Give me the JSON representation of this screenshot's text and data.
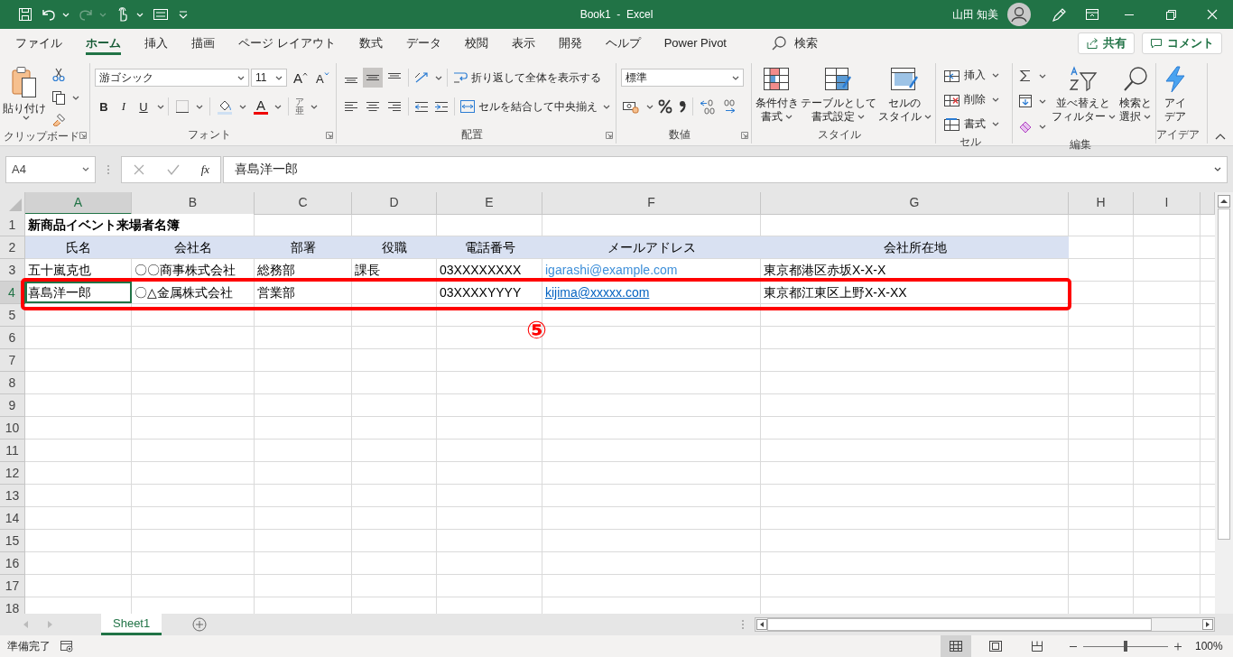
{
  "window": {
    "title": "Book1  -  Excel",
    "user": "山田 知美"
  },
  "quick_access": [
    {
      "kind": "save",
      "disabled": false
    },
    {
      "kind": "undo",
      "disabled": false
    },
    {
      "kind": "redo",
      "disabled": true
    },
    {
      "kind": "touch",
      "disabled": false
    },
    {
      "kind": "form",
      "disabled": false
    },
    {
      "kind": "customize",
      "disabled": false
    }
  ],
  "menu_tabs": [
    {
      "label": "ファイル",
      "selected": false
    },
    {
      "label": "ホーム",
      "selected": true
    },
    {
      "label": "挿入",
      "selected": false
    },
    {
      "label": "描画",
      "selected": false
    },
    {
      "label": "ページ レイアウト",
      "selected": false
    },
    {
      "label": "数式",
      "selected": false
    },
    {
      "label": "データ",
      "selected": false
    },
    {
      "label": "校閲",
      "selected": false
    },
    {
      "label": "表示",
      "selected": false
    },
    {
      "label": "開発",
      "selected": false
    },
    {
      "label": "ヘルプ",
      "selected": false
    },
    {
      "label": "Power Pivot",
      "selected": false
    }
  ],
  "search": {
    "label": "検索"
  },
  "share_button": "共有",
  "comment_button": "コメント",
  "ribbon": {
    "clipboard": {
      "label": "クリップボード",
      "launcher": true,
      "paste": "貼り付け"
    },
    "font": {
      "label": "フォント",
      "launcher": true,
      "font_name": "游ゴシック",
      "font_size": "11",
      "grow": "A",
      "shrink": "A",
      "format_buttons": [
        "B",
        "I",
        "U"
      ],
      "font_color": "A",
      "phonetic": [
        "ア",
        "亜"
      ]
    },
    "alignment": {
      "label": "配置",
      "launcher": true,
      "vertical_align": [
        {
          "selected": false
        },
        {
          "selected": true
        },
        {
          "selected": false
        }
      ],
      "wrap": "折り返して全体を表示する",
      "merge": "セルを結合して中央揃え"
    },
    "number": {
      "label": "数値",
      "launcher": true,
      "format": "標準"
    },
    "styles": {
      "label": "スタイル",
      "launcher": false,
      "buttons": [
        {
          "kind": "conditional",
          "label": [
            "条件付き",
            "書式"
          ]
        },
        {
          "kind": "table",
          "label": [
            "テーブルとして",
            "書式設定"
          ]
        },
        {
          "kind": "cellstyle",
          "label": [
            "セルの",
            "スタイル"
          ]
        }
      ]
    },
    "cells": {
      "label": "セル",
      "launcher": false,
      "buttons": [
        {
          "kind": "insert",
          "label": "挿入"
        },
        {
          "kind": "delete",
          "label": "削除"
        },
        {
          "kind": "format",
          "label": "書式"
        }
      ]
    },
    "editing": {
      "label": "編集",
      "launcher": false,
      "sort": [
        "並べ替えと",
        "フィルター"
      ],
      "find": [
        "検索と",
        "選択"
      ]
    },
    "ideas": {
      "label": "アイデア",
      "launcher": false,
      "button": [
        "アイ",
        "デア"
      ]
    }
  },
  "formula_bar": {
    "name_box": "A4",
    "function_label": "fx",
    "content": "喜島洋一郎"
  },
  "sheet": {
    "columns": [
      {
        "label": "A",
        "selected": true
      },
      {
        "label": "B",
        "selected": false
      },
      {
        "label": "C",
        "selected": false
      },
      {
        "label": "D",
        "selected": false
      },
      {
        "label": "E",
        "selected": false
      },
      {
        "label": "F",
        "selected": false
      },
      {
        "label": "G",
        "selected": false
      },
      {
        "label": "H",
        "selected": false
      },
      {
        "label": "I",
        "selected": false
      }
    ],
    "rows": [
      {
        "number": "1",
        "selected": false,
        "highlighted": false,
        "kind": "title",
        "cells": [
          {
            "text": "新商品イベント来場者名簿"
          }
        ]
      },
      {
        "number": "2",
        "selected": false,
        "highlighted": false,
        "kind": "header",
        "cells": [
          {
            "text": "氏名"
          },
          {
            "text": "会社名"
          },
          {
            "text": "部署"
          },
          {
            "text": "役職"
          },
          {
            "text": "電話番号"
          },
          {
            "text": "メールアドレス"
          },
          {
            "text": "会社所在地"
          }
        ]
      },
      {
        "number": "3",
        "selected": false,
        "highlighted": false,
        "kind": "data",
        "cells": [
          {
            "text": "五十嵐克也"
          },
          {
            "text": "〇〇商事株式会社"
          },
          {
            "text": "総務部"
          },
          {
            "text": "課長"
          },
          {
            "text": "03XXXXXXXX"
          },
          {
            "text": "igarashi@example.com",
            "kind": "link",
            "underlined": false
          },
          {
            "text": "東京都港区赤坂X-X-X"
          }
        ]
      },
      {
        "number": "4",
        "selected": true,
        "highlighted": true,
        "kind": "data",
        "cells": [
          {
            "text": "喜島洋一郎"
          },
          {
            "text": "〇△金属株式会社"
          },
          {
            "text": "営業部"
          },
          null,
          {
            "text": "03XXXXYYYY"
          },
          {
            "text": "kijima@xxxxx.com",
            "kind": "link",
            "underlined": true
          },
          {
            "text": "東京都江東区上野X-X-XX"
          }
        ]
      },
      {
        "number": "5",
        "selected": false,
        "highlighted": false,
        "kind": "data"
      },
      {
        "number": "6",
        "selected": false,
        "highlighted": false,
        "kind": "data"
      },
      {
        "number": "7",
        "selected": false,
        "highlighted": false,
        "kind": "data"
      },
      {
        "number": "8",
        "selected": false,
        "highlighted": false,
        "kind": "data"
      },
      {
        "number": "9",
        "selected": false,
        "highlighted": false,
        "kind": "data"
      },
      {
        "number": "10",
        "selected": false,
        "highlighted": false,
        "kind": "data"
      },
      {
        "number": "11",
        "selected": false,
        "highlighted": false,
        "kind": "data"
      },
      {
        "number": "12",
        "selected": false,
        "highlighted": false,
        "kind": "data"
      },
      {
        "number": "13",
        "selected": false,
        "highlighted": false,
        "kind": "data"
      },
      {
        "number": "14",
        "selected": false,
        "highlighted": false,
        "kind": "data"
      },
      {
        "number": "15",
        "selected": false,
        "highlighted": false,
        "kind": "data"
      },
      {
        "number": "16",
        "selected": false,
        "highlighted": false,
        "kind": "data"
      },
      {
        "number": "17",
        "selected": false,
        "highlighted": false,
        "kind": "data"
      },
      {
        "number": "18",
        "selected": false,
        "highlighted": false,
        "kind": "data"
      }
    ],
    "marker": "⑤"
  },
  "sheet_tabs": [
    {
      "label": "Sheet1",
      "selected": true
    }
  ],
  "status_bar": {
    "status": "準備完了",
    "views": [
      {
        "kind": "normal",
        "selected": true
      },
      {
        "kind": "page_layout",
        "selected": false
      },
      {
        "kind": "page_break",
        "selected": false
      }
    ],
    "zoom": {
      "level": 0.5,
      "label": "100%"
    }
  }
}
